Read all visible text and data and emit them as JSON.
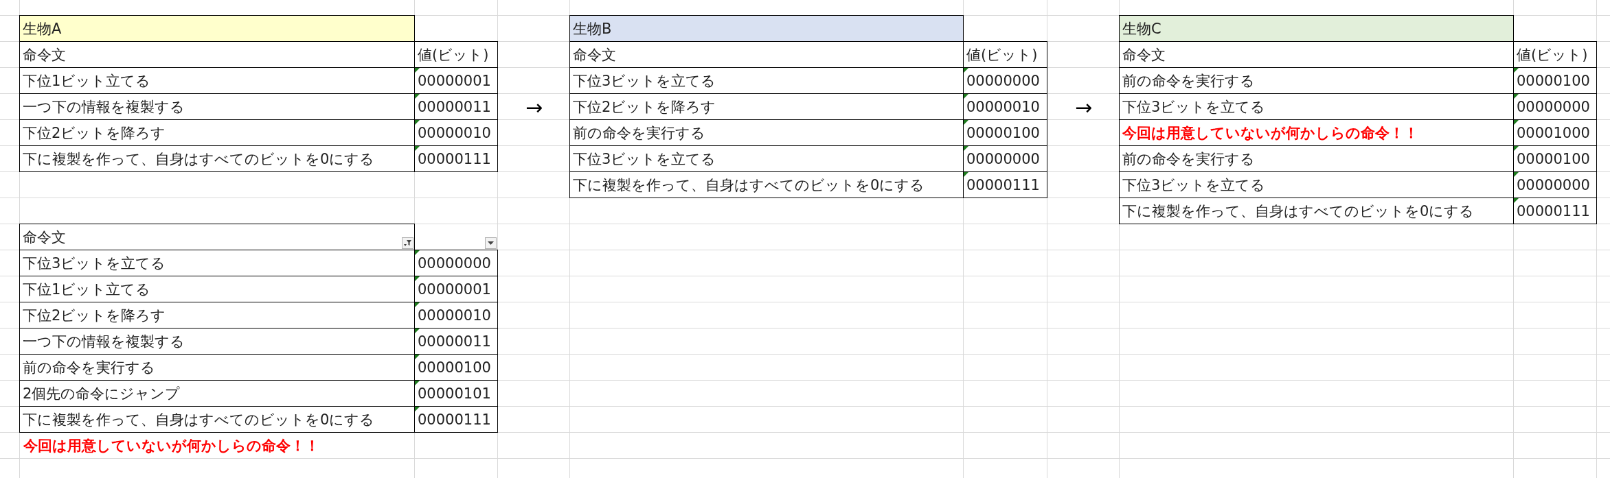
{
  "organisms": [
    {
      "title": "生物A",
      "color": "#ffffcc",
      "header": {
        "instruction": "命令文",
        "value": "値(ビット)"
      },
      "rows": [
        {
          "instruction": "下位1ビット立てる",
          "value": "00000001",
          "kind": "normal"
        },
        {
          "instruction": "一つ下の情報を複製する",
          "value": "00000011",
          "kind": "normal"
        },
        {
          "instruction": "下位2ビットを降ろす",
          "value": "00000010",
          "kind": "normal"
        },
        {
          "instruction": "下に複製を作って、自身はすべてのビットを0にする",
          "value": "00000111",
          "kind": "normal"
        }
      ]
    },
    {
      "title": "生物B",
      "color": "#d9e1f2",
      "header": {
        "instruction": "命令文",
        "value": "値(ビット)"
      },
      "rows": [
        {
          "instruction": "下位3ビットを立てる",
          "value": "00000000",
          "kind": "normal"
        },
        {
          "instruction": "下位2ビットを降ろす",
          "value": "00000010",
          "kind": "normal"
        },
        {
          "instruction": "前の命令を実行する",
          "value": "00000100",
          "kind": "normal"
        },
        {
          "instruction": "下位3ビットを立てる",
          "value": "00000000",
          "kind": "normal"
        },
        {
          "instruction": "下に複製を作って、自身はすべてのビットを0にする",
          "value": "00000111",
          "kind": "normal"
        }
      ]
    },
    {
      "title": "生物C",
      "color": "#e2efda",
      "header": {
        "instruction": "命令文",
        "value": "値(ビット)"
      },
      "rows": [
        {
          "instruction": "前の命令を実行する",
          "value": "00000100",
          "kind": "normal"
        },
        {
          "instruction": "下位3ビットを立てる",
          "value": "00000000",
          "kind": "normal"
        },
        {
          "instruction": "今回は用意していないが何かしらの命令！！",
          "value": "00001000",
          "kind": "note"
        },
        {
          "instruction": "前の命令を実行する",
          "value": "00000100",
          "kind": "normal"
        },
        {
          "instruction": "下位3ビットを立てる",
          "value": "00000000",
          "kind": "normal"
        },
        {
          "instruction": "下に複製を作って、自身はすべてのビットを0にする",
          "value": "00000111",
          "kind": "normal"
        }
      ]
    }
  ],
  "arrows": [
    "→",
    "→"
  ],
  "instruction_table": {
    "columns": [
      {
        "label": "命令文",
        "filtered": true
      },
      {
        "filtered": false
      }
    ],
    "rows": [
      {
        "instruction": "下位3ビットを立てる",
        "value": "00000000"
      },
      {
        "instruction": "下位1ビット立てる",
        "value": "00000001"
      },
      {
        "instruction": "下位2ビットを降ろす",
        "value": "00000010"
      },
      {
        "instruction": "一つ下の情報を複製する",
        "value": "00000011"
      },
      {
        "instruction": "前の命令を実行する",
        "value": "00000100"
      },
      {
        "instruction": "2個先の命令にジャンプ",
        "value": "00000101"
      },
      {
        "instruction": "下に複製を作って、自身はすべてのビットを0にする",
        "value": "00000111"
      }
    ],
    "note": "今回は用意していないが何かしらの命令！！"
  }
}
